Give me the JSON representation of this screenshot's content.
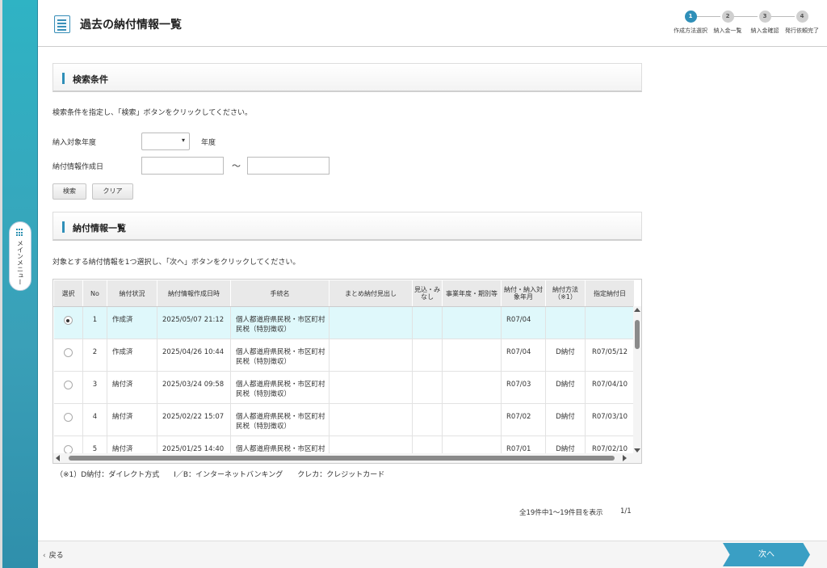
{
  "sidebar": {
    "menu_label": "メインメニュー"
  },
  "header": {
    "title": "過去の納付情報一覧"
  },
  "steps": [
    {
      "num": "1",
      "label": "作成方法選択",
      "active": true
    },
    {
      "num": "2",
      "label": "納入金一覧",
      "active": false
    },
    {
      "num": "3",
      "label": "納入金確認",
      "active": false
    },
    {
      "num": "4",
      "label": "発行依頼完了",
      "active": false
    }
  ],
  "search": {
    "section_title": "検索条件",
    "instruction": "検索条件を指定し、「検索」ボタンをクリックしてください。",
    "year_label": "納入対象年度",
    "year_value": "",
    "year_unit": "年度",
    "date_label": "納付情報作成日",
    "date_from": "",
    "date_to": "",
    "date_separator": "～",
    "search_button": "検索",
    "clear_button": "クリア"
  },
  "list": {
    "section_title": "納付情報一覧",
    "instruction": "対象とする納付情報を1つ選択し、「次へ」ボタンをクリックしてください。",
    "columns": [
      "選択",
      "No",
      "納付状況",
      "納付情報作成日時",
      "手続名",
      "まとめ納付見出し",
      "見込・みなし",
      "事業年度・期別等",
      "納付・納入対象年月",
      "納付方法（※1）",
      "指定納付日"
    ],
    "rows": [
      {
        "selected": true,
        "no": "1",
        "status": "作成済",
        "created": "2025/05/07 21:12",
        "procedure": "個人都道府県民税・市区町村民税（特別徴収）",
        "summary": "",
        "mikomi": "",
        "period": "",
        "target_month": "R07/04",
        "method": "",
        "due_date": ""
      },
      {
        "selected": false,
        "no": "2",
        "status": "作成済",
        "created": "2025/04/26 10:44",
        "procedure": "個人都道府県民税・市区町村民税（特別徴収）",
        "summary": "",
        "mikomi": "",
        "period": "",
        "target_month": "R07/04",
        "method": "D納付",
        "due_date": "R07/05/12"
      },
      {
        "selected": false,
        "no": "3",
        "status": "納付済",
        "created": "2025/03/24 09:58",
        "procedure": "個人都道府県民税・市区町村民税（特別徴収）",
        "summary": "",
        "mikomi": "",
        "period": "",
        "target_month": "R07/03",
        "method": "D納付",
        "due_date": "R07/04/10"
      },
      {
        "selected": false,
        "no": "4",
        "status": "納付済",
        "created": "2025/02/22 15:07",
        "procedure": "個人都道府県民税・市区町村民税（特別徴収）",
        "summary": "",
        "mikomi": "",
        "period": "",
        "target_month": "R07/02",
        "method": "D納付",
        "due_date": "R07/03/10"
      },
      {
        "selected": false,
        "no": "5",
        "status": "納付済",
        "created": "2025/01/25 14:40",
        "procedure": "個人都道府県民税・市区町村民税（特別徴収）",
        "summary": "",
        "mikomi": "",
        "period": "",
        "target_month": "R07/01",
        "method": "D納付",
        "due_date": "R07/02/10"
      }
    ],
    "footnote": "（※1）D納付：ダイレクト方式　　I／B：インターネットバンキング　　クレカ：クレジットカード",
    "count_text": "全19件中1～19件目を表示",
    "page": "1/1"
  },
  "footer": {
    "back_label": "戻る",
    "next_label": "次へ"
  },
  "colors": {
    "accent": "#2f8fb8",
    "selected_row": "#dff8fb",
    "next_button": "#3a9fc4",
    "rail": "#2fb3c4"
  }
}
